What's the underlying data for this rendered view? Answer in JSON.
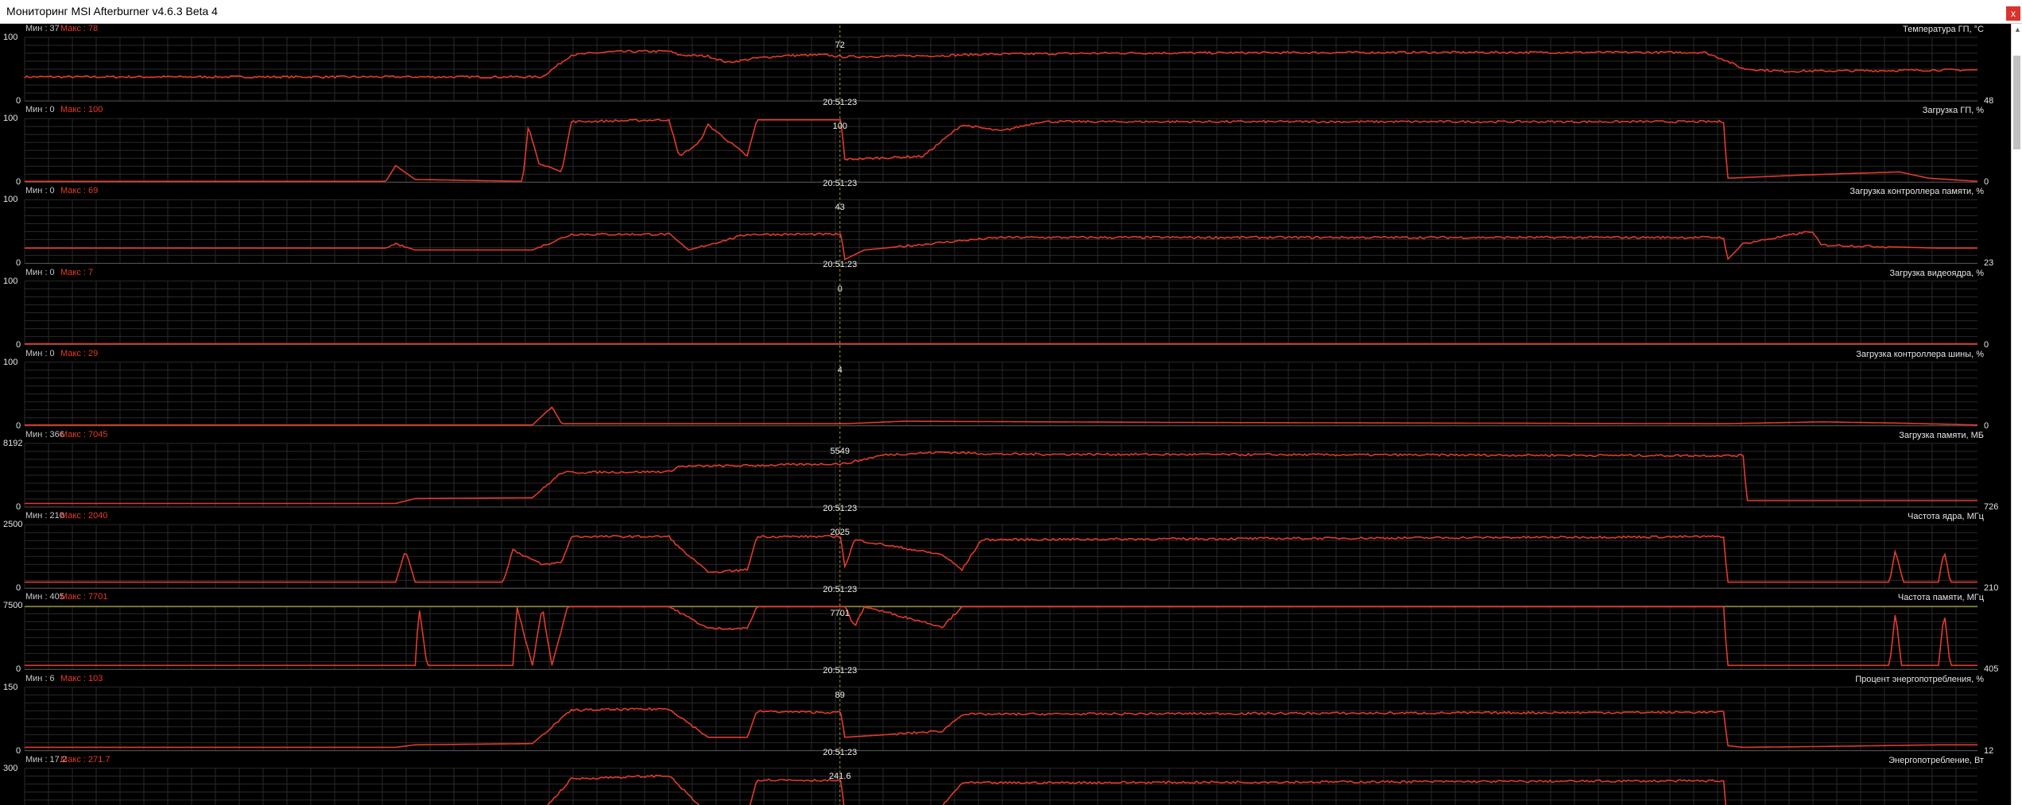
{
  "window": {
    "title": "Мониторинг MSI Afterburner v4.6.3 Beta 4",
    "close_glyph": "x"
  },
  "colors": {
    "background": "#000000",
    "grid": "#2a2a2a",
    "trace": "#e23a2a",
    "limit_line": "#8a8a32",
    "cursor_line": "#a89a3c",
    "min_text": "#c9c9c9",
    "max_text": "#e83a2a"
  },
  "icons": {
    "close": "close-icon",
    "scroll_up": "chevron-up-icon"
  },
  "cursor": {
    "time": "20:51:23"
  },
  "chart_data": {
    "type": "line",
    "panels": [
      {
        "title": "Температура ГП, °C",
        "min_label": "Мин : 37",
        "max_label": "Макс : 78",
        "y_top": "100",
        "y_bottom": "0",
        "ymax": 100,
        "cursor_value": "72",
        "current_value": "48",
        "show_time": true,
        "profile": [
          [
            0,
            37
          ],
          [
            0.265,
            37
          ],
          [
            0.28,
            72
          ],
          [
            0.3,
            77
          ],
          [
            0.33,
            78
          ],
          [
            0.335,
            72
          ],
          [
            0.35,
            70
          ],
          [
            0.36,
            60
          ],
          [
            0.375,
            67
          ],
          [
            0.39,
            71
          ],
          [
            0.41,
            72
          ],
          [
            0.418,
            69
          ],
          [
            0.47,
            71
          ],
          [
            0.49,
            73
          ],
          [
            0.56,
            75
          ],
          [
            0.71,
            76
          ],
          [
            0.86,
            76
          ],
          [
            0.87,
            65
          ],
          [
            0.88,
            50
          ],
          [
            0.9,
            46
          ],
          [
            0.95,
            47
          ],
          [
            0.98,
            48
          ],
          [
            1,
            48
          ]
        ]
      },
      {
        "title": "Загрузка ГП, %",
        "min_label": "Мин : 0",
        "max_label": "Макс : 100",
        "y_top": "100",
        "y_bottom": "0",
        "ymax": 100,
        "cursor_value": "100",
        "current_value": "0",
        "show_time": true,
        "profile": [
          [
            0,
            0
          ],
          [
            0.185,
            0
          ],
          [
            0.19,
            25
          ],
          [
            0.2,
            3
          ],
          [
            0.255,
            0
          ],
          [
            0.258,
            90
          ],
          [
            0.263,
            30
          ],
          [
            0.275,
            15
          ],
          [
            0.28,
            95
          ],
          [
            0.33,
            98
          ],
          [
            0.335,
            40
          ],
          [
            0.345,
            60
          ],
          [
            0.35,
            90
          ],
          [
            0.37,
            40
          ],
          [
            0.375,
            98
          ],
          [
            0.418,
            98
          ],
          [
            0.42,
            35
          ],
          [
            0.46,
            40
          ],
          [
            0.48,
            90
          ],
          [
            0.5,
            80
          ],
          [
            0.52,
            95
          ],
          [
            0.87,
            95
          ],
          [
            0.872,
            5
          ],
          [
            0.91,
            10
          ],
          [
            0.96,
            15
          ],
          [
            0.975,
            5
          ],
          [
            1,
            0
          ]
        ]
      },
      {
        "title": "Загрузка контроллера памяти, %",
        "min_label": "Мин : 0",
        "max_label": "Макс : 69",
        "y_top": "100",
        "y_bottom": "0",
        "ymax": 100,
        "cursor_value": "43",
        "current_value": "23",
        "show_time": true,
        "profile": [
          [
            0,
            23
          ],
          [
            0.185,
            23
          ],
          [
            0.19,
            30
          ],
          [
            0.2,
            20
          ],
          [
            0.26,
            20
          ],
          [
            0.28,
            45
          ],
          [
            0.33,
            45
          ],
          [
            0.34,
            20
          ],
          [
            0.37,
            45
          ],
          [
            0.418,
            45
          ],
          [
            0.42,
            5
          ],
          [
            0.43,
            20
          ],
          [
            0.48,
            35
          ],
          [
            0.5,
            40
          ],
          [
            0.87,
            40
          ],
          [
            0.872,
            5
          ],
          [
            0.88,
            30
          ],
          [
            0.915,
            50
          ],
          [
            0.92,
            28
          ],
          [
            0.98,
            23
          ],
          [
            1,
            23
          ]
        ]
      },
      {
        "title": "Загрузка видеоядра, %",
        "min_label": "Мин : 0",
        "max_label": "Макс : 7",
        "y_top": "100",
        "y_bottom": "0",
        "ymax": 100,
        "cursor_value": "0",
        "current_value": "0",
        "show_time": false,
        "profile": [
          [
            0,
            0
          ],
          [
            1,
            0
          ]
        ]
      },
      {
        "title": "Загрузка контроллера шины, %",
        "min_label": "Мин : 0",
        "max_label": "Макс : 29",
        "y_top": "100",
        "y_bottom": "0",
        "ymax": 100,
        "cursor_value": "4",
        "current_value": "0",
        "show_time": false,
        "profile": [
          [
            0,
            0
          ],
          [
            0.26,
            0
          ],
          [
            0.27,
            29
          ],
          [
            0.275,
            2
          ],
          [
            0.42,
            2
          ],
          [
            0.45,
            6
          ],
          [
            0.6,
            4
          ],
          [
            0.87,
            2
          ],
          [
            0.92,
            5
          ],
          [
            0.96,
            3
          ],
          [
            1,
            0
          ]
        ]
      },
      {
        "title": "Загрузка памяти, МБ",
        "min_label": "Мин : 366",
        "max_label": "Макс : 7045",
        "y_top": "8192",
        "y_bottom": "0",
        "ymax": 8192,
        "cursor_value": "5549",
        "current_value": "726",
        "show_time": true,
        "profile": [
          [
            0,
            366
          ],
          [
            0.19,
            366
          ],
          [
            0.2,
            1000
          ],
          [
            0.26,
            1100
          ],
          [
            0.275,
            4400
          ],
          [
            0.33,
            4500
          ],
          [
            0.335,
            5200
          ],
          [
            0.37,
            5300
          ],
          [
            0.418,
            5549
          ],
          [
            0.42,
            5549
          ],
          [
            0.44,
            6700
          ],
          [
            0.47,
            7045
          ],
          [
            0.5,
            6800
          ],
          [
            0.88,
            6600
          ],
          [
            0.882,
            726
          ],
          [
            1,
            726
          ]
        ]
      },
      {
        "title": "Частота ядра, МГц",
        "min_label": "Мин : 210",
        "max_label": "Макс : 2040",
        "y_top": "2500",
        "y_bottom": "0",
        "ymax": 2500,
        "cursor_value": "2025",
        "current_value": "210",
        "show_time": true,
        "profile": [
          [
            0,
            210
          ],
          [
            0.19,
            210
          ],
          [
            0.195,
            1500
          ],
          [
            0.2,
            210
          ],
          [
            0.245,
            210
          ],
          [
            0.25,
            1500
          ],
          [
            0.265,
            900
          ],
          [
            0.275,
            1000
          ],
          [
            0.28,
            2025
          ],
          [
            0.33,
            2025
          ],
          [
            0.335,
            1600
          ],
          [
            0.35,
            600
          ],
          [
            0.37,
            700
          ],
          [
            0.375,
            2025
          ],
          [
            0.418,
            2025
          ],
          [
            0.42,
            800
          ],
          [
            0.425,
            1900
          ],
          [
            0.47,
            1300
          ],
          [
            0.48,
            700
          ],
          [
            0.49,
            1900
          ],
          [
            0.87,
            2025
          ],
          [
            0.872,
            210
          ],
          [
            0.955,
            210
          ],
          [
            0.958,
            1500
          ],
          [
            0.962,
            210
          ],
          [
            0.98,
            210
          ],
          [
            0.983,
            1500
          ],
          [
            0.986,
            210
          ],
          [
            1,
            210
          ]
        ]
      },
      {
        "title": "Частота памяти, МГц",
        "min_label": "Мин : 405",
        "max_label": "Макс : 7701",
        "y_top": "7500",
        "y_bottom": "0",
        "ymax": 7800,
        "cursor_value": "7701",
        "current_value": "405",
        "show_time": true,
        "limit_value": 7701,
        "profile": [
          [
            0,
            405
          ],
          [
            0.2,
            405
          ],
          [
            0.202,
            7701
          ],
          [
            0.206,
            405
          ],
          [
            0.25,
            405
          ],
          [
            0.252,
            7701
          ],
          [
            0.26,
            405
          ],
          [
            0.265,
            7701
          ],
          [
            0.27,
            405
          ],
          [
            0.278,
            7701
          ],
          [
            0.33,
            7701
          ],
          [
            0.35,
            5000
          ],
          [
            0.37,
            5000
          ],
          [
            0.375,
            7701
          ],
          [
            0.42,
            7701
          ],
          [
            0.425,
            5200
          ],
          [
            0.43,
            7701
          ],
          [
            0.47,
            5200
          ],
          [
            0.48,
            7701
          ],
          [
            0.87,
            7701
          ],
          [
            0.872,
            405
          ],
          [
            0.955,
            405
          ],
          [
            0.958,
            7000
          ],
          [
            0.961,
            405
          ],
          [
            0.98,
            405
          ],
          [
            0.983,
            7000
          ],
          [
            0.986,
            405
          ],
          [
            1,
            405
          ]
        ]
      },
      {
        "title": "Процент энергопотребления, %",
        "min_label": "Мин : 6",
        "max_label": "Макс : 103",
        "y_top": "150",
        "y_bottom": "0",
        "ymax": 150,
        "cursor_value": "89",
        "current_value": "12",
        "show_time": true,
        "profile": [
          [
            0,
            6
          ],
          [
            0.19,
            6
          ],
          [
            0.2,
            12
          ],
          [
            0.26,
            15
          ],
          [
            0.28,
            95
          ],
          [
            0.33,
            98
          ],
          [
            0.35,
            30
          ],
          [
            0.37,
            30
          ],
          [
            0.375,
            92
          ],
          [
            0.418,
            89
          ],
          [
            0.42,
            30
          ],
          [
            0.47,
            45
          ],
          [
            0.48,
            85
          ],
          [
            0.87,
            90
          ],
          [
            0.872,
            10
          ],
          [
            0.88,
            6
          ],
          [
            0.92,
            8
          ],
          [
            0.98,
            12
          ],
          [
            1,
            12
          ]
        ]
      },
      {
        "title": "Энергопотребление, Вт",
        "min_label": "Мин : 17.2",
        "max_label": "Макс : 271.7",
        "y_top": "300",
        "y_bottom": "0",
        "ymax": 300,
        "cursor_value": "241.6",
        "current_value": "",
        "show_time": false,
        "profile": [
          [
            0,
            17
          ],
          [
            0.19,
            17
          ],
          [
            0.2,
            30
          ],
          [
            0.26,
            40
          ],
          [
            0.28,
            250
          ],
          [
            0.33,
            265
          ],
          [
            0.35,
            80
          ],
          [
            0.37,
            80
          ],
          [
            0.375,
            245
          ],
          [
            0.418,
            241.6
          ],
          [
            0.42,
            80
          ],
          [
            0.47,
            120
          ],
          [
            0.48,
            230
          ],
          [
            0.87,
            240
          ],
          [
            0.872,
            25
          ],
          [
            0.9,
            17.2
          ],
          [
            1,
            17.2
          ]
        ]
      }
    ]
  }
}
